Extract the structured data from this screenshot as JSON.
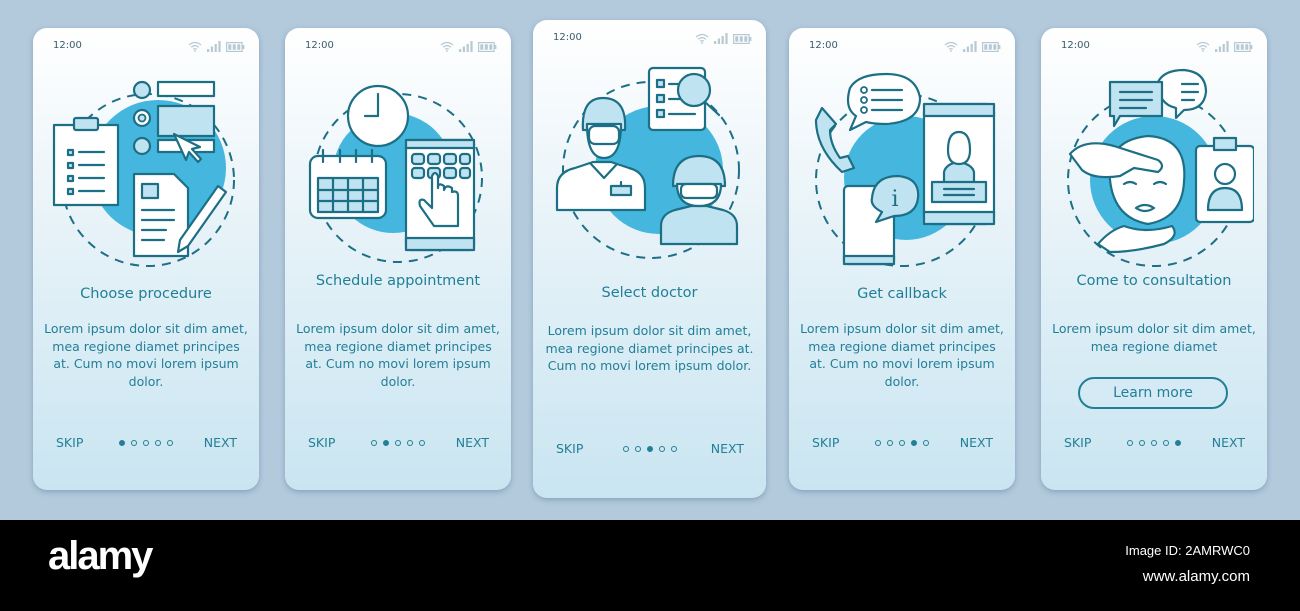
{
  "status_bar": {
    "time": "12:00",
    "icons": [
      "wifi-icon",
      "signal-icon",
      "battery-icon"
    ]
  },
  "screens": [
    {
      "title": "Choose procedure",
      "body": "Lorem ipsum dolor sit dim amet, mea regione diamet principes at. Cum no movi lorem ipsum dolor.",
      "illustration": "procedure-selection-illustration",
      "skip": "SKIP",
      "next": "NEXT",
      "active_page": 1,
      "total_pages": 5
    },
    {
      "title": "Schedule appointment",
      "body": "Lorem ipsum dolor sit dim amet, mea regione diamet principes at. Cum no movi lorem ipsum dolor.",
      "illustration": "calendar-clock-tablet-illustration",
      "skip": "SKIP",
      "next": "NEXT",
      "active_page": 2,
      "total_pages": 5
    },
    {
      "title": "Select doctor",
      "body": "Lorem ipsum dolor sit dim amet, mea regione diamet principes at. Cum no movi lorem ipsum dolor.",
      "illustration": "doctors-search-illustration",
      "skip": "SKIP",
      "next": "NEXT",
      "active_page": 3,
      "total_pages": 5
    },
    {
      "title": "Get callback",
      "body": "Lorem ipsum dolor sit dim amet, mea regione diamet principes at. Cum no movi lorem ipsum dolor.",
      "illustration": "phone-callback-illustration",
      "skip": "SKIP",
      "next": "NEXT",
      "active_page": 4,
      "total_pages": 5
    },
    {
      "title": "Come to consultation",
      "body": "Lorem ipsum dolor sit dim amet, mea regione diamet",
      "illustration": "patient-consultation-illustration",
      "button": "Learn more",
      "skip": "SKIP",
      "next": "NEXT",
      "active_page": 5,
      "total_pages": 5
    }
  ],
  "footer": {
    "logo": "alamy",
    "image_id": "Image ID: 2AMRWC0",
    "site": "www.alamy.com"
  },
  "colors": {
    "background": "#b3cadd",
    "text": "#237f97",
    "accent": "#45b7de",
    "line": "#1d6f85"
  }
}
